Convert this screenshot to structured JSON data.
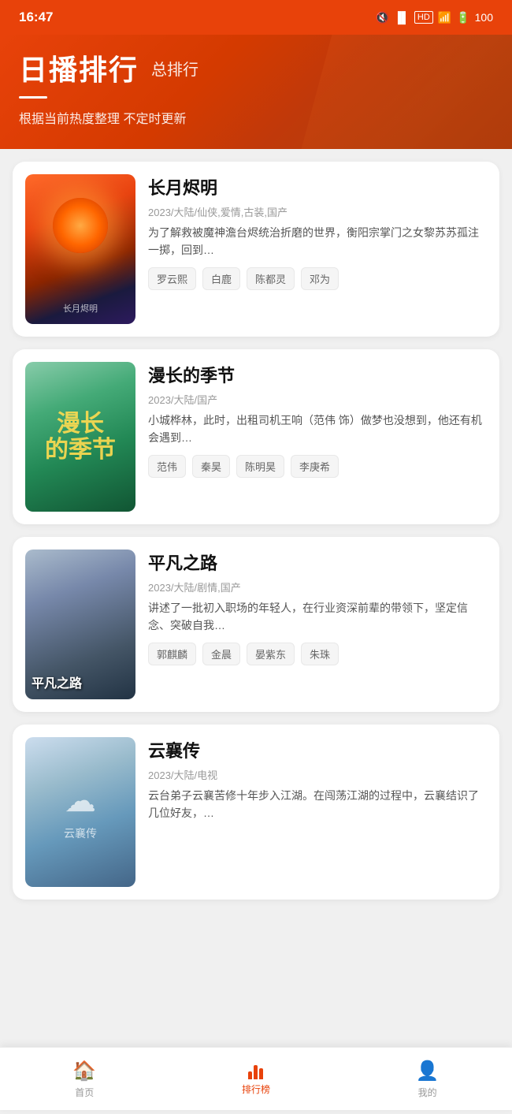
{
  "statusBar": {
    "time": "16:47",
    "battery": "100"
  },
  "header": {
    "mainTitle": "日播排行",
    "subTitle": "总排行",
    "description": "根据当前热度整理 不定时更新"
  },
  "cards": [
    {
      "id": "card-1",
      "title": "长月烬明",
      "meta": "2023/大陆/仙侠,爱情,古装,国产",
      "desc": "为了解救被魔神澹台烬统治折磨的世界，衡阳宗掌门之女黎苏苏孤注一掷，回到…",
      "tags": [
        "罗云熙",
        "白鹿",
        "陈都灵",
        "邓为"
      ],
      "posterType": "1"
    },
    {
      "id": "card-2",
      "title": "漫长的季节",
      "meta": "2023/大陆/国产",
      "desc": "小城桦林，此时，出租司机王响（范伟 饰）做梦也没想到，他还有机会遇到…",
      "tags": [
        "范伟",
        "秦昊",
        "陈明昊",
        "李庚希"
      ],
      "posterType": "2"
    },
    {
      "id": "card-3",
      "title": "平凡之路",
      "meta": "2023/大陆/剧情,国产",
      "desc": "讲述了一批初入职场的年轻人，在行业资深前辈的带领下，坚定信念、突破自我…",
      "tags": [
        "郭麒麟",
        "金晨",
        "晏紫东",
        "朱珠"
      ],
      "posterType": "3",
      "posterText": "平凡之路"
    },
    {
      "id": "card-4",
      "title": "云襄传",
      "meta": "2023/大陆/电视",
      "desc": "云台弟子云襄苦修十年步入江湖。在闯荡江湖的过程中，云襄结识了几位好友，…",
      "tags": [],
      "posterType": "4"
    }
  ],
  "bottomNav": {
    "items": [
      {
        "id": "home",
        "label": "首页",
        "active": false
      },
      {
        "id": "ranking",
        "label": "排行榜",
        "active": true
      },
      {
        "id": "mine",
        "label": "我的",
        "active": false
      }
    ]
  }
}
